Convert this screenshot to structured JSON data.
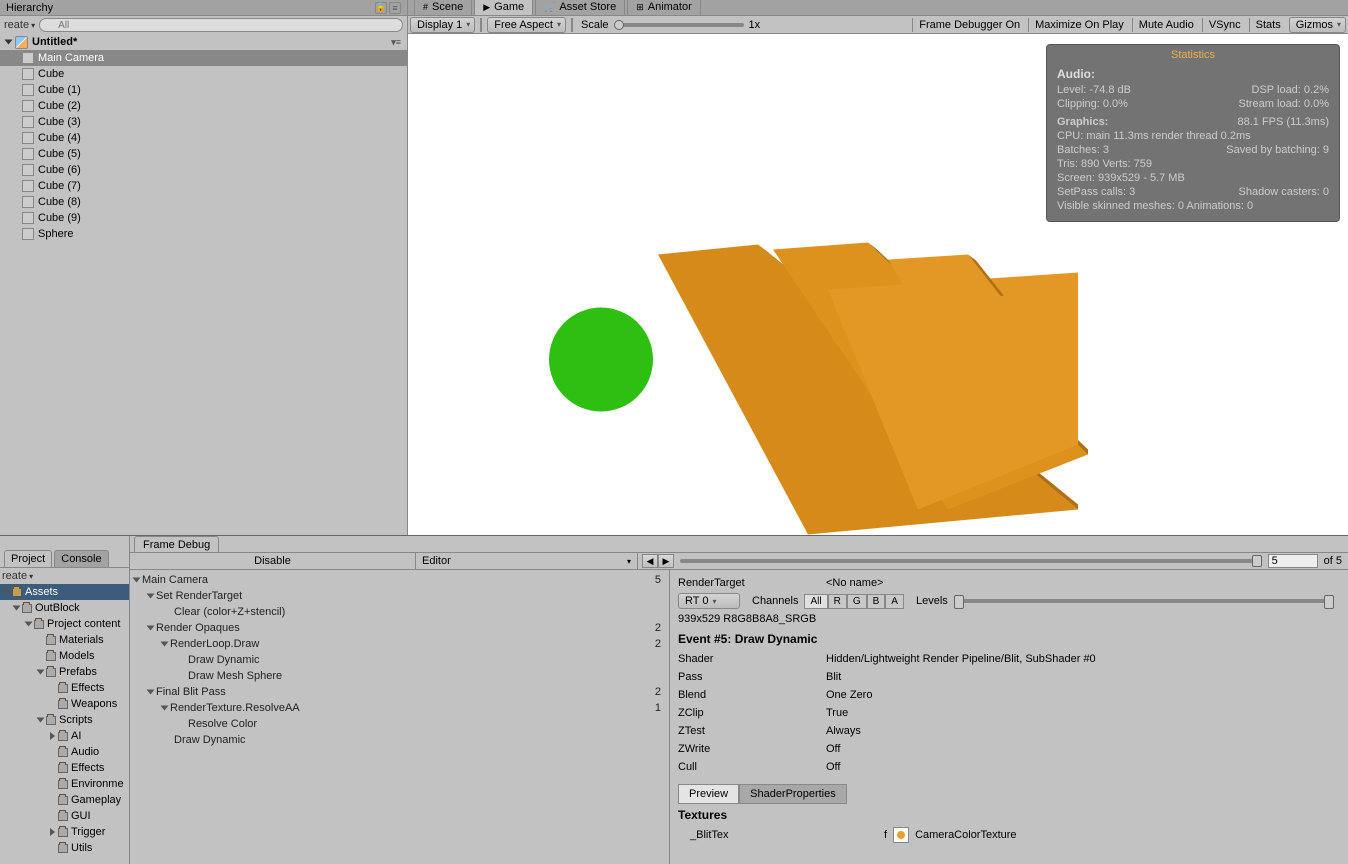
{
  "hierarchy": {
    "title": "Hierarchy",
    "create": "reate",
    "search_placeholder": "All",
    "scene": "Untitled*",
    "items": [
      "Main Camera",
      "Cube",
      "Cube (1)",
      "Cube (2)",
      "Cube (3)",
      "Cube (4)",
      "Cube (5)",
      "Cube (6)",
      "Cube (7)",
      "Cube (8)",
      "Cube (9)",
      "Sphere"
    ]
  },
  "game_tabs": [
    "Scene",
    "Game",
    "Asset Store",
    "Animator"
  ],
  "game_toolbar": {
    "display": "Display 1",
    "aspect": "Free Aspect",
    "scale_label": "Scale",
    "scale_value": "1x",
    "frame_debug": "Frame Debugger On",
    "maximize": "Maximize On Play",
    "mute": "Mute Audio",
    "vsync": "VSync",
    "stats": "Stats",
    "gizmos": "Gizmos"
  },
  "stats": {
    "title": "Statistics",
    "audio": "Audio:",
    "level": "Level: -74.8 dB",
    "clip": "Clipping: 0.0%",
    "dsp": "DSP load: 0.2%",
    "stream": "Stream load: 0.0%",
    "graphics": "Graphics:",
    "fps": "88.1 FPS (11.3ms)",
    "cpu": "CPU: main 11.3ms  render thread 0.2ms",
    "batches": "Batches: 3",
    "saved": "Saved by batching: 9",
    "tris": "Tris: 890 Verts: 759",
    "screen": "Screen: 939x529 - 5.7 MB",
    "setpass": "SetPass calls: 3",
    "shadow": "Shadow casters: 0",
    "skinned": "Visible skinned meshes: 0  Animations: 0"
  },
  "project": {
    "tab1": "Project",
    "tab2": "Console",
    "create": "reate",
    "root": "Assets",
    "tree": [
      {
        "t": "OutBlock",
        "d": 1,
        "tri": "open"
      },
      {
        "t": "Project content",
        "d": 2,
        "tri": "open"
      },
      {
        "t": "Materials",
        "d": 3
      },
      {
        "t": "Models",
        "d": 3
      },
      {
        "t": "Prefabs",
        "d": 3,
        "tri": "open"
      },
      {
        "t": "Effects",
        "d": 4
      },
      {
        "t": "Weapons",
        "d": 4
      },
      {
        "t": "Scripts",
        "d": 3,
        "tri": "open"
      },
      {
        "t": "AI",
        "d": 4,
        "tri": "closed"
      },
      {
        "t": "Audio",
        "d": 4
      },
      {
        "t": "Effects",
        "d": 4
      },
      {
        "t": "Environme",
        "d": 4
      },
      {
        "t": "Gameplay",
        "d": 4
      },
      {
        "t": "GUI",
        "d": 4
      },
      {
        "t": "Trigger",
        "d": 4,
        "tri": "closed"
      },
      {
        "t": "Utils",
        "d": 4
      }
    ]
  },
  "framedebug": {
    "tab": "Frame Debug",
    "disable": "Disable",
    "editor": "Editor",
    "current": "5",
    "total": "of 5",
    "tree": [
      {
        "t": "Main Camera",
        "d": 0,
        "n": "5",
        "tri": true
      },
      {
        "t": "Set RenderTarget",
        "d": 1,
        "tri": true
      },
      {
        "t": "Clear (color+Z+stencil)",
        "d": 2
      },
      {
        "t": "Render Opaques",
        "d": 1,
        "n": "2",
        "tri": true
      },
      {
        "t": "RenderLoop.Draw",
        "d": 2,
        "n": "2",
        "tri": true
      },
      {
        "t": "Draw Dynamic",
        "d": 3
      },
      {
        "t": "Draw Mesh Sphere",
        "d": 3
      },
      {
        "t": "Final Blit Pass",
        "d": 1,
        "n": "2",
        "tri": true
      },
      {
        "t": "RenderTexture.ResolveAA",
        "d": 2,
        "n": "1",
        "tri": true
      },
      {
        "t": "Resolve Color",
        "d": 3
      },
      {
        "t": "Draw Dynamic",
        "d": 2
      }
    ],
    "detail": {
      "rt_label": "RenderTarget",
      "rt_value": "<No name>",
      "rt_dd": "RT 0",
      "channels": "Channels",
      "ch": [
        "All",
        "R",
        "G",
        "B",
        "A"
      ],
      "levels": "Levels",
      "dim": "939x529 R8G8B8A8_SRGB",
      "event": "Event #5: Draw Dynamic",
      "rows": [
        [
          "Shader",
          "Hidden/Lightweight Render Pipeline/Blit, SubShader #0"
        ],
        [
          "Pass",
          "Blit"
        ],
        [
          "Blend",
          "One Zero"
        ],
        [
          "ZClip",
          "True"
        ],
        [
          "ZTest",
          "Always"
        ],
        [
          "ZWrite",
          "Off"
        ],
        [
          "Cull",
          "Off"
        ]
      ],
      "preview": "Preview",
      "shaderprops": "ShaderProperties",
      "textures": "Textures",
      "blit": "_BlitTex",
      "blitval": "CameraColorTexture",
      "f": "f"
    }
  }
}
